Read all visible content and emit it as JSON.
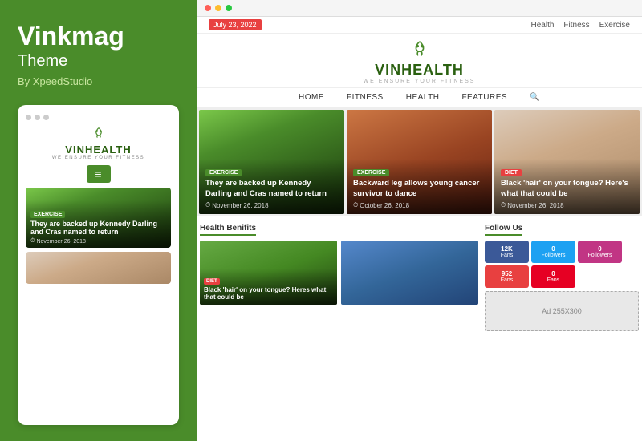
{
  "sidebar": {
    "title": "Vinkmag",
    "subtitle": "Theme",
    "by": "By XpeedStudio",
    "dots": [
      "gray",
      "gray",
      "gray"
    ],
    "mobile": {
      "logo_name": "VINHEALTH",
      "logo_sub": "WE ENSURE YOUR FITNESS",
      "menu_icon": "≡",
      "article": {
        "badge": "EXERCISE",
        "title": "They are backed up Kennedy Darling and Cras named to return",
        "date": "November 26, 2018"
      }
    }
  },
  "browser": {
    "dots": [
      "red",
      "yellow",
      "green"
    ]
  },
  "topbar": {
    "date": "July 23, 2022",
    "links": [
      "Health",
      "Fitness",
      "Exercise"
    ]
  },
  "logo": {
    "name": "VINHEALTH",
    "sub": "WE ENSURE YOUR FITNESS"
  },
  "nav": {
    "items": [
      "HOME",
      "FITNESS",
      "HEALTH",
      "FEATURES"
    ],
    "search_icon": "🔍"
  },
  "articles": [
    {
      "badge": "EXERCISE",
      "badge_class": "badge-exercise",
      "title": "They are backed up Kennedy Darling and Cras named to return",
      "date": "November 26, 2018",
      "bg_class": "img-runners"
    },
    {
      "badge": "EXERCISE",
      "badge_class": "badge-exercise",
      "title": "Backward leg allows young cancer survivor to dance",
      "date": "October 26, 2018",
      "bg_class": "img-gym"
    },
    {
      "badge": "DIET",
      "badge_class": "badge-diet",
      "title": "Black 'hair' on your tongue? Here's what that could be",
      "date": "November 26, 2018",
      "bg_class": "img-fitness"
    }
  ],
  "sections": {
    "health_benefits": {
      "heading": "Health Benifits",
      "articles": [
        {
          "badge": "DIET",
          "title": "Black 'hair' on your tongue? Heres what that could be",
          "bg_class": "img-man-fruit"
        },
        {
          "bg_class": "img-berries"
        }
      ]
    },
    "follow_us": {
      "heading": "Follow Us",
      "social": [
        {
          "count": "12K",
          "label": "Fans",
          "class": "social-fb",
          "icon": "f"
        },
        {
          "count": "0",
          "label": "Followers",
          "class": "social-tw",
          "icon": "t"
        },
        {
          "count": "0",
          "label": "Followers",
          "class": "social-ig",
          "icon": "in"
        },
        {
          "count": "952",
          "label": "Fans",
          "class": "social-yt",
          "icon": "▶"
        },
        {
          "count": "0",
          "label": "Fans",
          "class": "social-pi",
          "icon": "P"
        }
      ],
      "ad": {
        "label": "Ad 255X300"
      }
    }
  }
}
